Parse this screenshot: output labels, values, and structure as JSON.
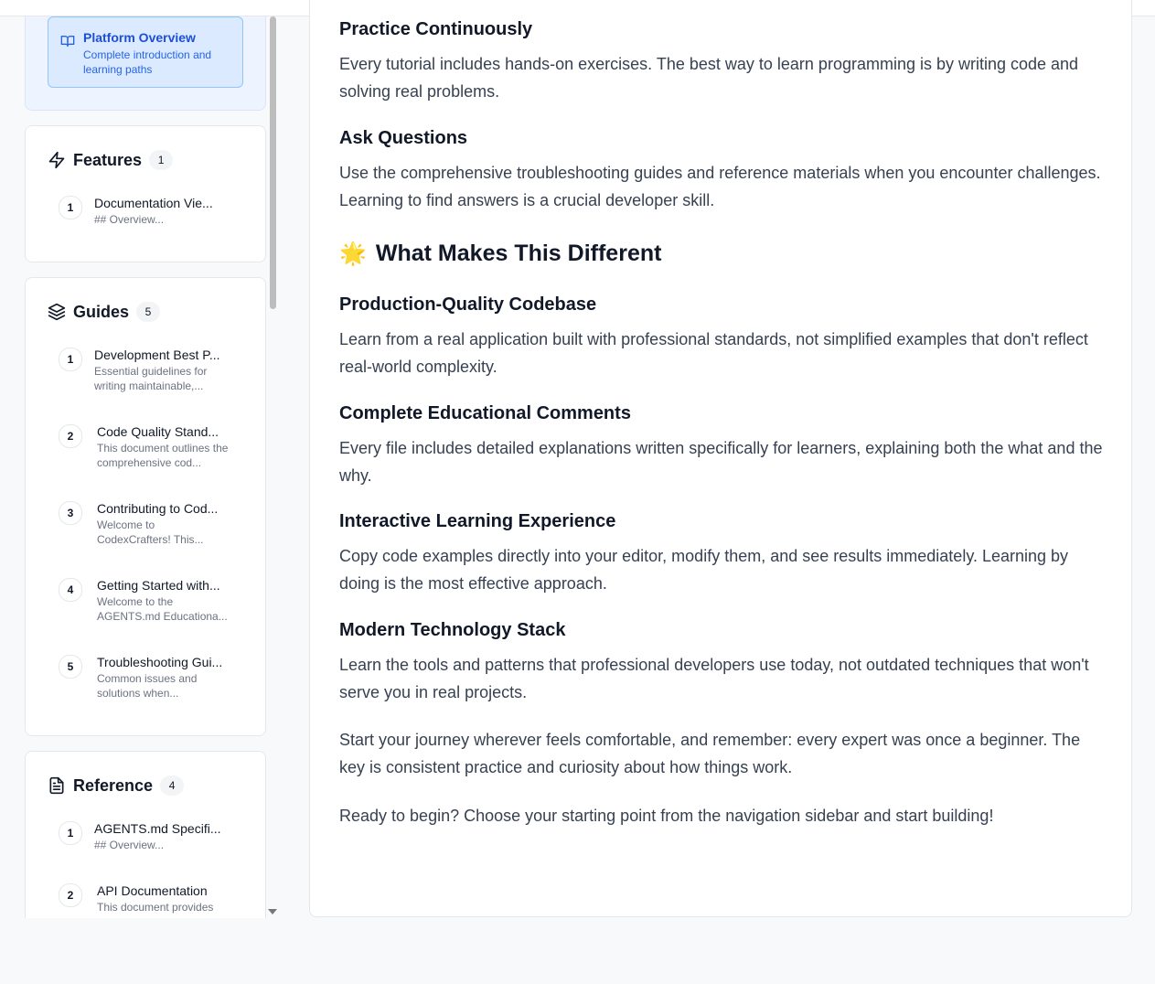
{
  "sidebar": {
    "overview": {
      "title": "Platform Overview",
      "description": "Complete introduction and learning paths"
    },
    "sections": [
      {
        "title": "Features",
        "count": "1",
        "icon": "zap-icon",
        "items": [
          {
            "num": "1",
            "title": "Documentation Vie...",
            "desc": "## Overview..."
          }
        ]
      },
      {
        "title": "Guides",
        "count": "5",
        "icon": "layers-icon",
        "items": [
          {
            "num": "1",
            "title": "Development Best P...",
            "desc": "Essential guidelines for writing maintainable,..."
          },
          {
            "num": "2",
            "title": "Code Quality Stand...",
            "desc": "This document outlines the comprehensive cod..."
          },
          {
            "num": "3",
            "title": "Contributing to Cod...",
            "desc": "Welcome to CodexCrafters! This..."
          },
          {
            "num": "4",
            "title": "Getting Started with...",
            "desc": "Welcome to the AGENTS.md Educationa..."
          },
          {
            "num": "5",
            "title": "Troubleshooting Gui...",
            "desc": "Common issues and solutions when..."
          }
        ]
      },
      {
        "title": "Reference",
        "count": "4",
        "icon": "file-text-icon",
        "items": [
          {
            "num": "1",
            "title": "AGENTS.md Specifi...",
            "desc": "## Overview..."
          },
          {
            "num": "2",
            "title": "API Documentation",
            "desc": "This document provides"
          }
        ]
      }
    ]
  },
  "content": {
    "practice_heading": "Practice Continuously",
    "practice_text": "Every tutorial includes hands-on exercises. The best way to learn programming is by writing code and solving real problems.",
    "ask_heading": "Ask Questions",
    "ask_text": "Use the comprehensive troubleshooting guides and reference materials when you encounter challenges. Learning to find answers is a crucial developer skill.",
    "different_emoji": "🌟",
    "different_heading": "What Makes This Different",
    "quality_heading": "Production-Quality Codebase",
    "quality_text": "Learn from a real application built with professional standards, not simplified examples that don't reflect real-world complexity.",
    "comments_heading": "Complete Educational Comments",
    "comments_text": "Every file includes detailed explanations written specifically for learners, explaining both the what and the why.",
    "interactive_heading": "Interactive Learning Experience",
    "interactive_text": "Copy code examples directly into your editor, modify them, and see results immediately. Learning by doing is the most effective approach.",
    "stack_heading": "Modern Technology Stack",
    "stack_text": "Learn the tools and patterns that professional developers use today, not outdated techniques that won't serve you in real projects.",
    "journey_text": "Start your journey wherever feels comfortable, and remember: every expert was once a beginner. The key is consistent practice and curiosity about how things work.",
    "ready_text": "Ready to begin? Choose your starting point from the navigation sidebar and start building!"
  },
  "colors": {
    "accent": "#1d4ed8",
    "overview_bg": "#dbeafe",
    "text": "#374151"
  }
}
